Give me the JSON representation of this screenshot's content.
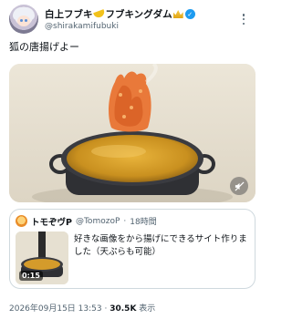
{
  "author": {
    "display_name": "白上フブキ",
    "name_suffix": "フブキングダム",
    "handle": "@shirakamifubuki",
    "verified_color": "#1d9bf0"
  },
  "tweet": {
    "text": "狐の唐揚げよー"
  },
  "media": {
    "mute_icon": "speaker-muted-icon"
  },
  "quote": {
    "display_name": "トモぞヴP",
    "handle": "@TomozoP",
    "separator": "·",
    "time_ago": "18時間",
    "text": "好きな画像をから揚げにできるサイト作りました（天ぷらも可能）",
    "video_duration": "0:15"
  },
  "footer": {
    "timestamp": "2026年09月15日 13:53",
    "separator": "·",
    "views_count": "30.5K",
    "views_label": "表示"
  },
  "colors": {
    "text": "#0f1419",
    "secondary": "#536471",
    "border": "#cfd9de",
    "accent": "#1d9bf0"
  }
}
